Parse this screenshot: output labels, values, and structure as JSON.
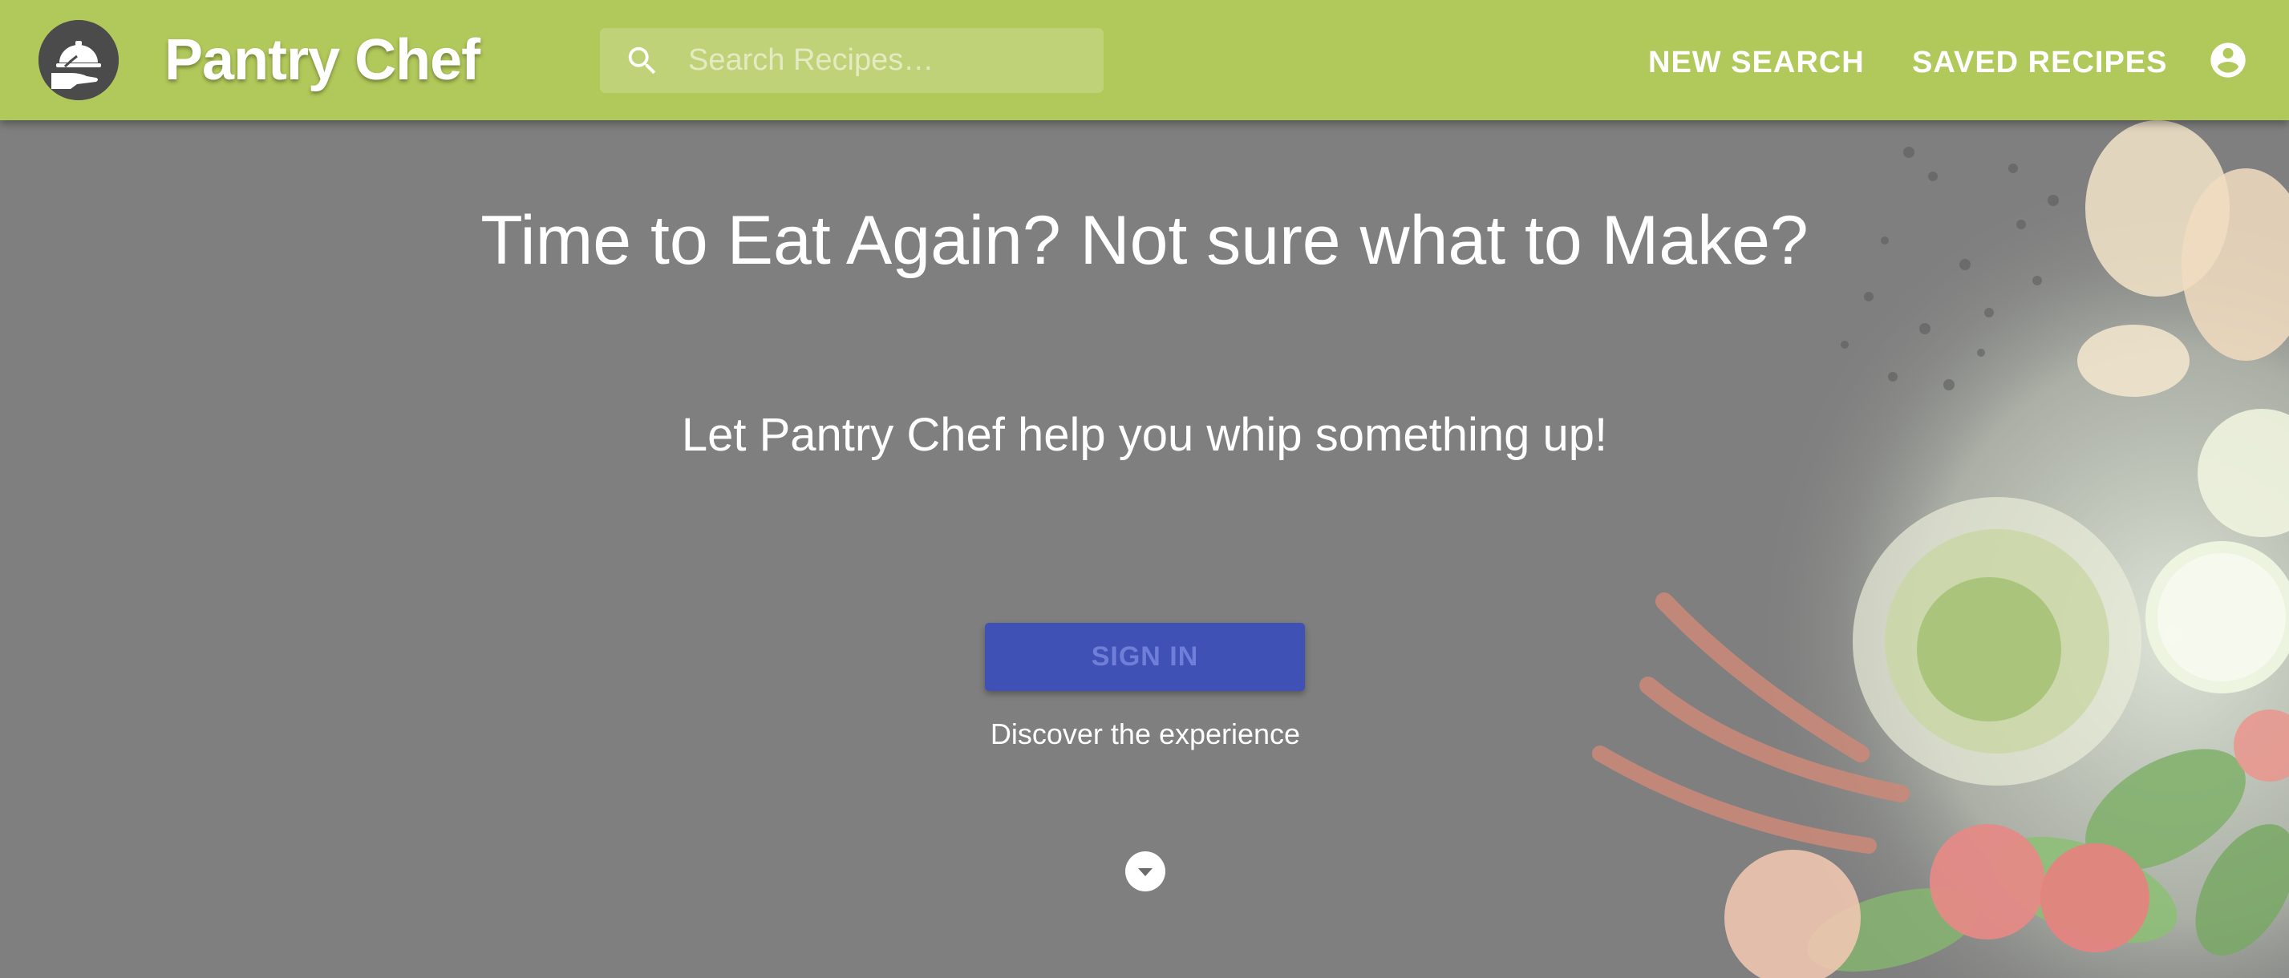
{
  "app": {
    "title": "Pantry Chef",
    "logo_icon": "cloche-hand-icon",
    "colors": {
      "appbar": "#b1c85a",
      "overlay": "#7f7f7f",
      "primary_button": "#3f51b5",
      "primary_button_text": "#6f7fd9",
      "text": "#ffffff"
    }
  },
  "header": {
    "search": {
      "placeholder": "Search Recipes…",
      "value": "",
      "icon": "search-icon"
    },
    "nav": {
      "new_search": "NEW SEARCH",
      "saved_recipes": "SAVED RECIPES"
    },
    "account_icon": "account-circle-icon"
  },
  "hero": {
    "headline": "Time to Eat Again? Not sure what to Make?",
    "subheadline": "Let Pantry Chef help you whip something up!",
    "signin_label": "SIGN IN",
    "caption": "Discover the experience",
    "scroll_icon": "chevron-down-circle-icon",
    "background_image": "faded-food-ingredients-photo"
  }
}
